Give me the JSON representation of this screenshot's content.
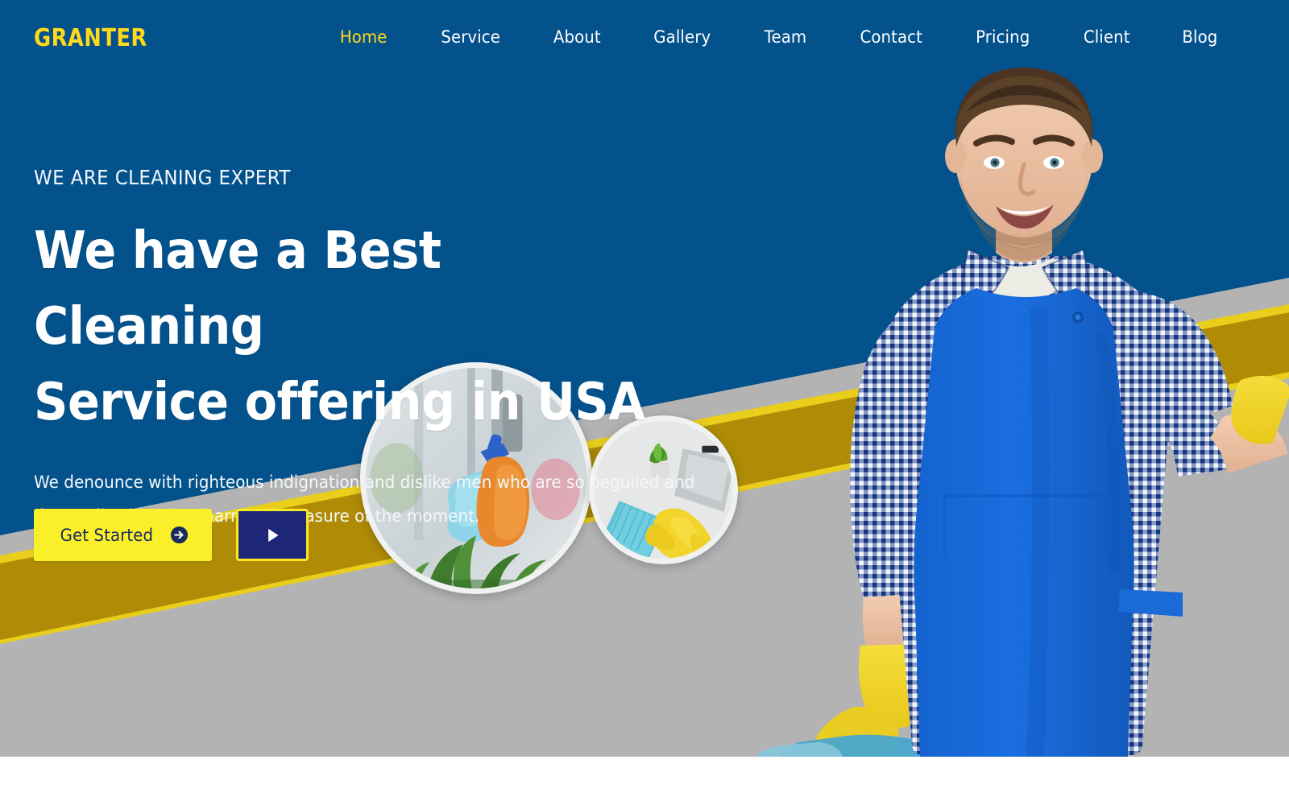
{
  "brand": {
    "logo_text": "GRANTER",
    "logo_color": "#FFD91A"
  },
  "colors": {
    "primary_blue": "#04528C",
    "accent_yellow": "#FAF02A",
    "band_gold": "#B08C06",
    "band_yellow": "#E9CE1C",
    "gray_floor": "#B3B3B3",
    "video_navy": "#1E2677"
  },
  "nav": {
    "items": [
      {
        "label": "Home",
        "active": true
      },
      {
        "label": "Service",
        "active": false
      },
      {
        "label": "About",
        "active": false
      },
      {
        "label": "Gallery",
        "active": false
      },
      {
        "label": "Team",
        "active": false
      },
      {
        "label": "Contact",
        "active": false
      },
      {
        "label": "Pricing",
        "active": false
      },
      {
        "label": "Client",
        "active": false
      },
      {
        "label": "Blog",
        "active": false
      }
    ]
  },
  "hero": {
    "eyebrow": "WE ARE CLEANING EXPERT",
    "headline_line1": "We have a Best Cleaning",
    "headline_line2": "Service offering in USA",
    "paragraph": "We denounce with righteous indignation and dislike men who are so beguiled and demoralized by the charms of pleasure of the moment.",
    "primary_button": {
      "label": "Get Started",
      "icon": "arrow-circle-right-icon"
    },
    "video_button": {
      "icon": "play-icon",
      "label": ""
    },
    "images": [
      {
        "name": "spray-bottle-cleaning-photo",
        "alt": "Orange gloved hand spraying a window with a blue spray bottle above green plants"
      },
      {
        "name": "desk-wiping-photo",
        "alt": "Yellow gloved hand wiping a white desk with a teal cloth beside a laptop and succulent"
      },
      {
        "name": "cleaner-man-photo",
        "alt": "Smiling man in checkered shirt and blue apron with yellow rubber gloves"
      }
    ]
  }
}
